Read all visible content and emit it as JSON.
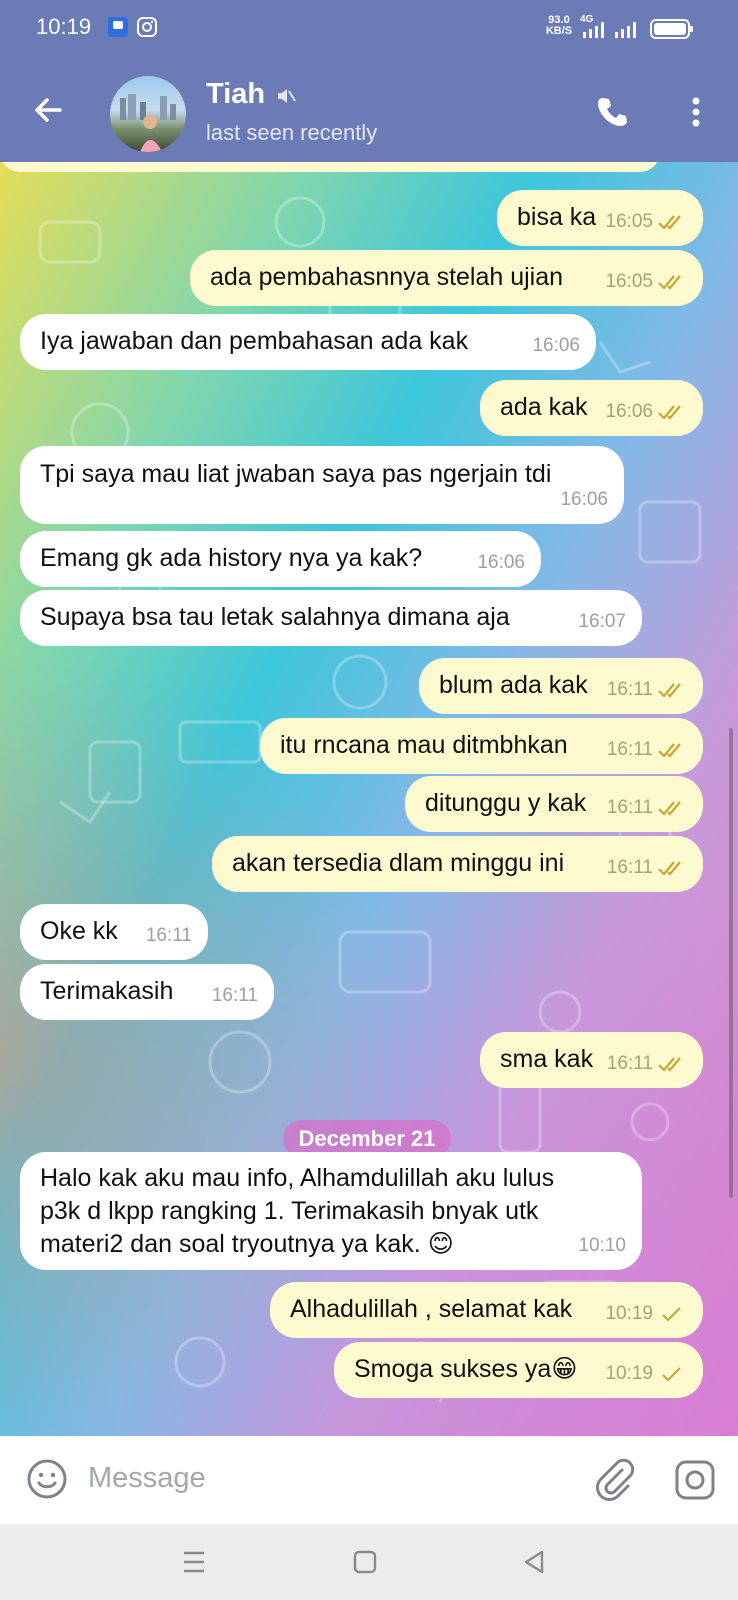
{
  "status_bar": {
    "time": "10:19",
    "net_speed": "93.0\nKB/S",
    "network": "4G"
  },
  "header": {
    "contact_name": "Tiah",
    "last_seen": "last seen recently"
  },
  "messages": [
    {
      "dir": "out",
      "text": "bisa ka",
      "time": "16:05",
      "status": "read"
    },
    {
      "dir": "out",
      "text": "ada pembahasnnya stelah ujian",
      "time": "16:05",
      "status": "read"
    },
    {
      "dir": "in",
      "text": "Iya jawaban dan pembahasan ada kak",
      "time": "16:06"
    },
    {
      "dir": "out",
      "text": "ada kak",
      "time": "16:06",
      "status": "read"
    },
    {
      "dir": "in",
      "text": "Tpi saya mau liat jwaban saya pas ngerjain tdi",
      "time": "16:06"
    },
    {
      "dir": "in",
      "text": "Emang gk ada history nya ya kak?",
      "time": "16:06"
    },
    {
      "dir": "in",
      "text": "Supaya bsa tau letak salahnya dimana aja",
      "time": "16:07"
    },
    {
      "dir": "out",
      "text": "blum ada kak",
      "time": "16:11",
      "status": "read"
    },
    {
      "dir": "out",
      "text": "itu rncana mau ditmbhkan",
      "time": "16:11",
      "status": "read"
    },
    {
      "dir": "out",
      "text": "ditunggu y kak",
      "time": "16:11",
      "status": "read"
    },
    {
      "dir": "out",
      "text": "akan tersedia dlam minggu ini",
      "time": "16:11",
      "status": "read"
    },
    {
      "dir": "in",
      "text": "Oke kk",
      "time": "16:11"
    },
    {
      "dir": "in",
      "text": "Terimakasih",
      "time": "16:11"
    },
    {
      "dir": "out",
      "text": "sma kak",
      "time": "16:11",
      "status": "read"
    },
    {
      "dir": "in",
      "text": "Halo kak aku mau info, Alhamdulillah aku lulus\np3k d lkpp rangking 1. Terimakasih bnyak utk\nmateri2 dan soal tryoutnya ya kak. 😊",
      "time": "10:10"
    },
    {
      "dir": "out",
      "text": "Alhadulillah , selamat kak",
      "time": "10:19",
      "status": "sent"
    },
    {
      "dir": "out",
      "text": "Smoga sukses ya😁",
      "time": "10:19",
      "status": "sent"
    }
  ],
  "date_separator": "December 21",
  "composer": {
    "placeholder": "Message"
  },
  "colors": {
    "header": "#6b7bb5",
    "outgoing_bubble": "#fdfad0",
    "incoming_bubble": "#ffffff",
    "date_pill": "#d670c8"
  },
  "icons": [
    "back-arrow-icon",
    "mute-icon",
    "phone-icon",
    "more-vert-icon",
    "emoji-icon",
    "attach-icon",
    "camera-icon",
    "menu-icon",
    "home-icon",
    "back-icon"
  ]
}
